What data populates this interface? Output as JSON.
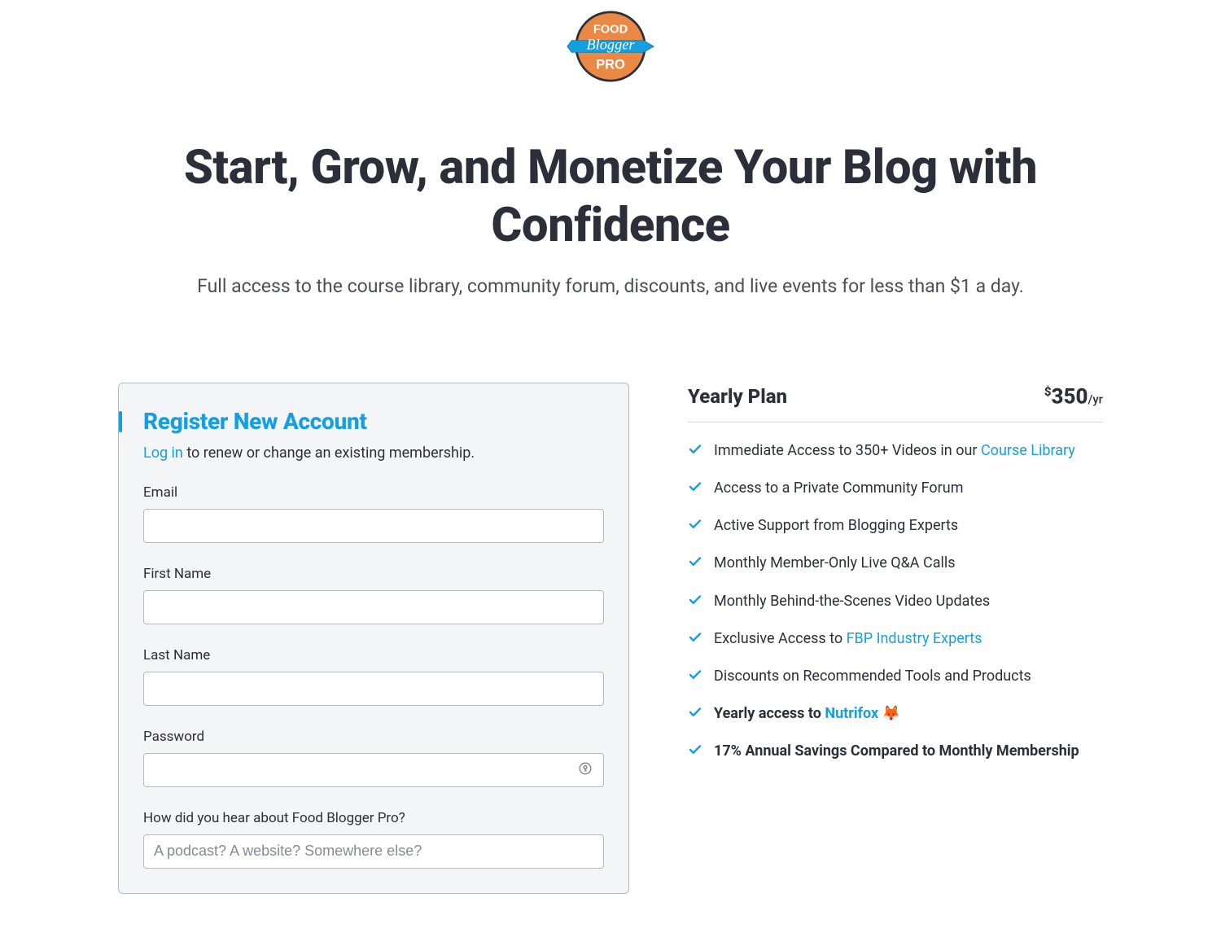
{
  "logo": {
    "top_text": "FOOD",
    "mid_text": "Blogger",
    "bot_text": "PRO"
  },
  "hero": {
    "title": "Start, Grow, and Monetize Your Blog with Confidence",
    "subtitle": "Full access to the course library, community forum, discounts, and live events for less than $1 a day."
  },
  "form": {
    "title": "Register New Account",
    "login_link": "Log in",
    "login_rest": " to renew or change an existing membership.",
    "email_label": "Email",
    "first_name_label": "First Name",
    "last_name_label": "Last Name",
    "password_label": "Password",
    "heard_label": "How did you hear about Food Blogger Pro?",
    "heard_placeholder": "A podcast? A website? Somewhere else?"
  },
  "plan": {
    "name": "Yearly Plan",
    "currency": "$",
    "price": "350",
    "per": "/yr",
    "features": [
      {
        "pre": "Immediate Access to 350+ Videos in our ",
        "link": "Course Library",
        "post": "",
        "bold": false
      },
      {
        "pre": "Access to a Private Community Forum",
        "link": "",
        "post": "",
        "bold": false
      },
      {
        "pre": "Active Support from Blogging Experts",
        "link": "",
        "post": "",
        "bold": false
      },
      {
        "pre": "Monthly Member-Only Live Q&A Calls",
        "link": "",
        "post": "",
        "bold": false
      },
      {
        "pre": "Monthly Behind-the-Scenes Video Updates",
        "link": "",
        "post": "",
        "bold": false
      },
      {
        "pre": "Exclusive Access to ",
        "link": "FBP Industry Experts",
        "post": "",
        "bold": false
      },
      {
        "pre": "Discounts on Recommended Tools and Products",
        "link": "",
        "post": "",
        "bold": false
      },
      {
        "pre": "Yearly access to ",
        "link": "Nutrifox",
        "post": " 🦊",
        "bold": true
      },
      {
        "pre": "17% Annual Savings Compared to Monthly Membership",
        "link": "",
        "post": "",
        "bold": true
      }
    ]
  }
}
